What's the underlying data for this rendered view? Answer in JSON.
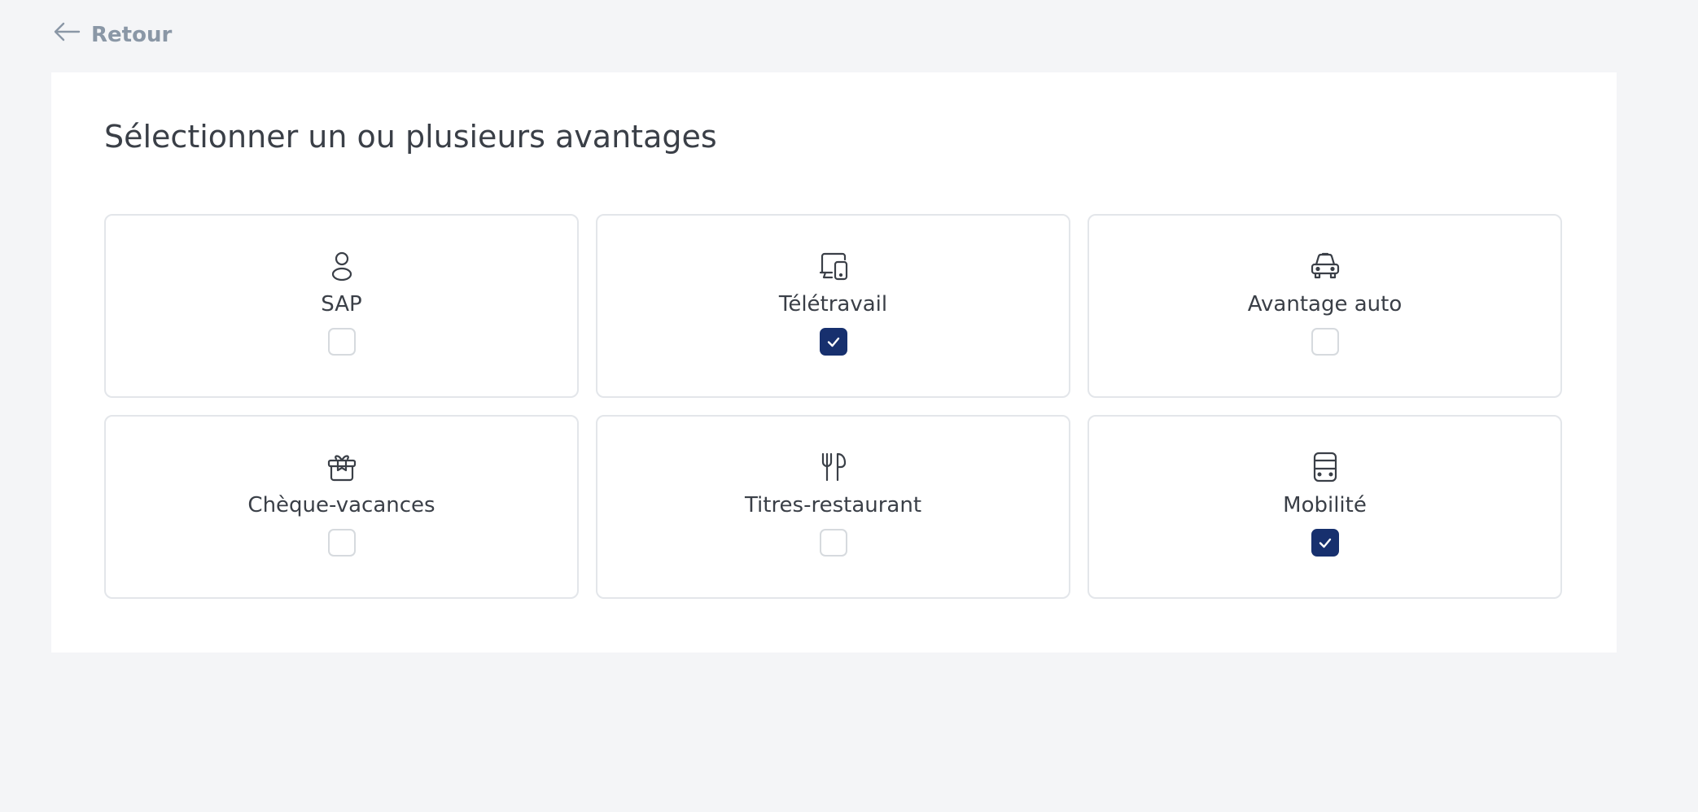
{
  "back": {
    "label": "Retour",
    "icon": "arrow-left-icon"
  },
  "title": "Sélectionner un ou plusieurs avantages",
  "colors": {
    "accent": "#17306e",
    "background": "#f4f5f7",
    "card_border": "#e3e6ea"
  },
  "benefits": [
    {
      "label": "SAP",
      "icon": "person-icon",
      "checked": false
    },
    {
      "label": "Télétravail",
      "icon": "devices-icon",
      "checked": true
    },
    {
      "label": "Avantage auto",
      "icon": "car-icon",
      "checked": false
    },
    {
      "label": "Chèque-vacances",
      "icon": "gift-box-icon",
      "checked": false
    },
    {
      "label": "Titres-restaurant",
      "icon": "utensils-icon",
      "checked": false
    },
    {
      "label": "Mobilité",
      "icon": "bus-icon",
      "checked": true
    }
  ]
}
